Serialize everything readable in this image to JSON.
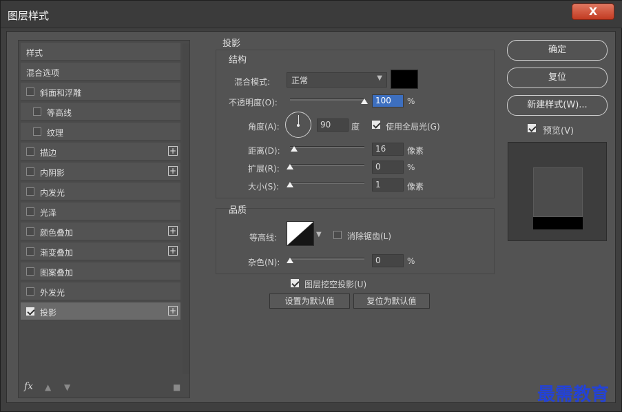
{
  "window": {
    "title": "图层样式",
    "close_label": "X"
  },
  "styles_panel": {
    "items": [
      {
        "label": "样式",
        "checkbox": false,
        "checked": false,
        "plus": false,
        "indent": 0,
        "selected": false
      },
      {
        "label": "混合选项",
        "checkbox": false,
        "checked": false,
        "plus": false,
        "indent": 0,
        "selected": false
      },
      {
        "label": "斜面和浮雕",
        "checkbox": true,
        "checked": false,
        "plus": false,
        "indent": 0,
        "selected": false
      },
      {
        "label": "等高线",
        "checkbox": true,
        "checked": false,
        "plus": false,
        "indent": 1,
        "selected": false
      },
      {
        "label": "纹理",
        "checkbox": true,
        "checked": false,
        "plus": false,
        "indent": 1,
        "selected": false
      },
      {
        "label": "描边",
        "checkbox": true,
        "checked": false,
        "plus": true,
        "indent": 0,
        "selected": false
      },
      {
        "label": "内阴影",
        "checkbox": true,
        "checked": false,
        "plus": true,
        "indent": 0,
        "selected": false
      },
      {
        "label": "内发光",
        "checkbox": true,
        "checked": false,
        "plus": false,
        "indent": 0,
        "selected": false
      },
      {
        "label": "光泽",
        "checkbox": true,
        "checked": false,
        "plus": false,
        "indent": 0,
        "selected": false
      },
      {
        "label": "颜色叠加",
        "checkbox": true,
        "checked": false,
        "plus": true,
        "indent": 0,
        "selected": false
      },
      {
        "label": "渐变叠加",
        "checkbox": true,
        "checked": false,
        "plus": true,
        "indent": 0,
        "selected": false
      },
      {
        "label": "图案叠加",
        "checkbox": true,
        "checked": false,
        "plus": false,
        "indent": 0,
        "selected": false
      },
      {
        "label": "外发光",
        "checkbox": true,
        "checked": false,
        "plus": false,
        "indent": 0,
        "selected": false
      },
      {
        "label": "投影",
        "checkbox": true,
        "checked": true,
        "plus": true,
        "indent": 0,
        "selected": true
      }
    ],
    "footer": {
      "fx_label": "fx"
    }
  },
  "drop_shadow": {
    "title": "投影",
    "structure": {
      "title": "结构",
      "blend_mode_label": "混合模式:",
      "blend_mode_value": "正常",
      "shadow_color": "#000000",
      "opacity_label": "不透明度(O):",
      "opacity_value": "100",
      "opacity_unit": "%",
      "opacity_fraction": 1.0,
      "angle_label": "角度(A):",
      "angle_value": "90",
      "angle_unit": "度",
      "global_light_label": "使用全局光(G)",
      "global_light_checked": true,
      "distance_label": "距离(D):",
      "distance_value": "16",
      "distance_unit": "像素",
      "distance_fraction": 0.06,
      "spread_label": "扩展(R):",
      "spread_value": "0",
      "spread_unit": "%",
      "spread_fraction": 0.0,
      "size_label": "大小(S):",
      "size_value": "1",
      "size_unit": "像素",
      "size_fraction": 0.0
    },
    "quality": {
      "title": "品质",
      "contour_label": "等高线:",
      "antialias_label": "消除锯齿(L)",
      "antialias_checked": false,
      "noise_label": "杂色(N):",
      "noise_value": "0",
      "noise_unit": "%",
      "noise_fraction": 0.0
    },
    "knockout_label": "图层挖空投影(U)",
    "knockout_checked": true,
    "set_default_label": "设置为默认值",
    "reset_default_label": "复位为默认值"
  },
  "actions": {
    "ok_label": "确定",
    "reset_label": "复位",
    "new_style_label": "新建样式(W)...",
    "preview_label": "预览(V)",
    "preview_checked": true
  },
  "watermark": "最需教育",
  "colors": {
    "panel": "#535353",
    "selection": "#3d6fbf",
    "watermark": "#2342d7"
  }
}
